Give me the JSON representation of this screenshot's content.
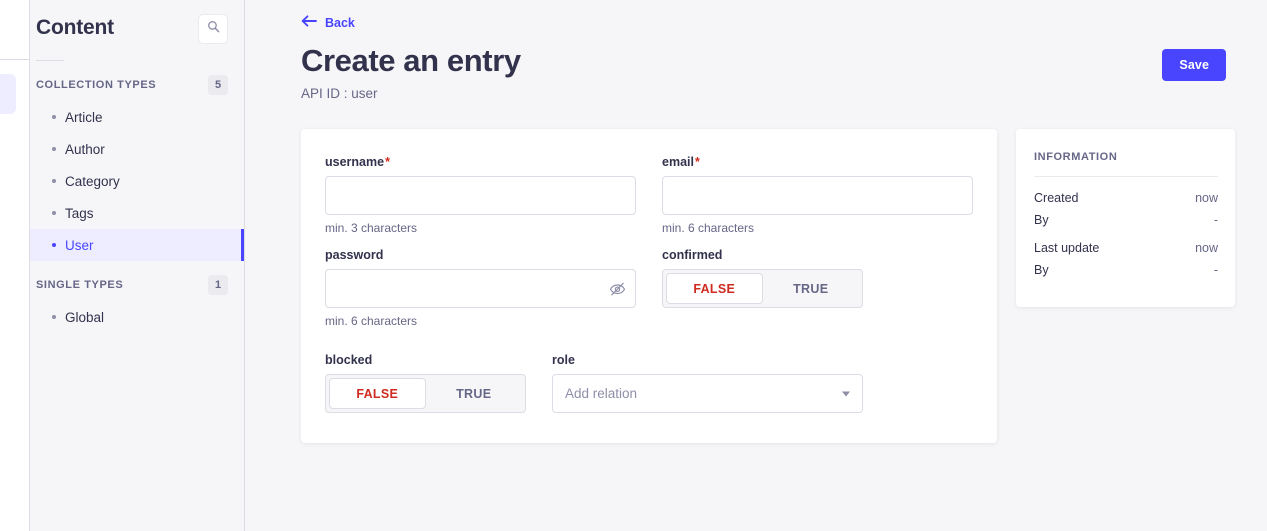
{
  "rail": {
    "active_item_name": "content-manager"
  },
  "sidebar": {
    "title": "Content",
    "search_icon": "search-icon",
    "groups": [
      {
        "label": "COLLECTION TYPES",
        "count": "5",
        "items": [
          {
            "label": "Article",
            "active": false
          },
          {
            "label": "Author",
            "active": false
          },
          {
            "label": "Category",
            "active": false
          },
          {
            "label": "Tags",
            "active": false
          },
          {
            "label": "User",
            "active": true
          }
        ]
      },
      {
        "label": "SINGLE TYPES",
        "count": "1",
        "items": [
          {
            "label": "Global",
            "active": false
          }
        ]
      }
    ]
  },
  "header": {
    "back_label": "Back",
    "back_icon": "arrow-left-icon",
    "title": "Create an entry",
    "api_id": "API ID : user",
    "save_label": "Save",
    "accent_color": "#4945ff"
  },
  "form": {
    "username": {
      "label": "username",
      "required_marker": "*",
      "value": "",
      "placeholder": "",
      "hint": "min. 3 characters"
    },
    "email": {
      "label": "email",
      "required_marker": "*",
      "value": "",
      "placeholder": "",
      "hint": "min. 6 characters"
    },
    "password": {
      "label": "password",
      "value": "",
      "placeholder": "",
      "hint": "min. 6 characters",
      "toggle_icon": "eye-slash-icon"
    },
    "confirmed": {
      "label": "confirmed",
      "false_label": "FALSE",
      "true_label": "TRUE",
      "selected": "FALSE"
    },
    "blocked": {
      "label": "blocked",
      "false_label": "FALSE",
      "true_label": "TRUE",
      "selected": "FALSE"
    },
    "role": {
      "label": "role",
      "placeholder": "Add relation",
      "value": "",
      "caret_icon": "chevron-down-icon"
    }
  },
  "information": {
    "title": "INFORMATION",
    "rows": [
      {
        "key": "Created",
        "value": "now"
      },
      {
        "key": "By",
        "value": "-"
      },
      {
        "key": "Last update",
        "value": "now"
      },
      {
        "key": "By",
        "value": "-"
      }
    ]
  }
}
